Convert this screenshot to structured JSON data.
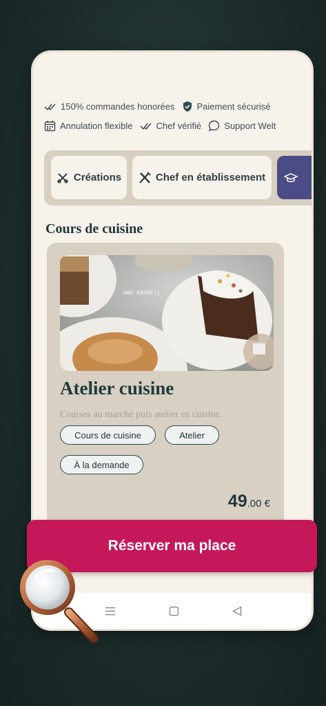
{
  "trust_badges": {
    "row1": [
      {
        "icon": "double-check-icon",
        "label": "150% commandes honorées"
      },
      {
        "icon": "shield-check-icon",
        "label": "Paiement sécurisé"
      }
    ],
    "row2": [
      {
        "icon": "calendar-icon",
        "label": "Annulation flexible"
      },
      {
        "icon": "double-check-icon",
        "label": "Chef vérifié"
      },
      {
        "icon": "chat-bubble-icon",
        "label": "Support Welt"
      }
    ]
  },
  "tabs": [
    {
      "icon": "tools-icon",
      "label": "Créations"
    },
    {
      "icon": "utensils-icon",
      "label": "Chef en établissement"
    },
    {
      "icon": "graduation-cap-icon",
      "label": ""
    }
  ],
  "section": {
    "title": "Cours de cuisine"
  },
  "card": {
    "photo_caption": "AND ENJOY:)",
    "title": "Atelier cuisine",
    "description": "Courses au marché puis atelier en cuisine.",
    "tags": [
      "Cours de cuisine",
      "Atelier",
      "À la demande"
    ],
    "price_main": "49",
    "price_decimal": ".00 €"
  },
  "cta": {
    "label": "Réserver ma place"
  },
  "navbar": {
    "icons": [
      "menu-icon",
      "home-square-icon",
      "back-triangle-icon"
    ]
  },
  "colors": {
    "accent": "#c4185a",
    "ink": "#21373c",
    "tab_active": "#4b4c86",
    "card_bg": "#d8d0c3"
  }
}
